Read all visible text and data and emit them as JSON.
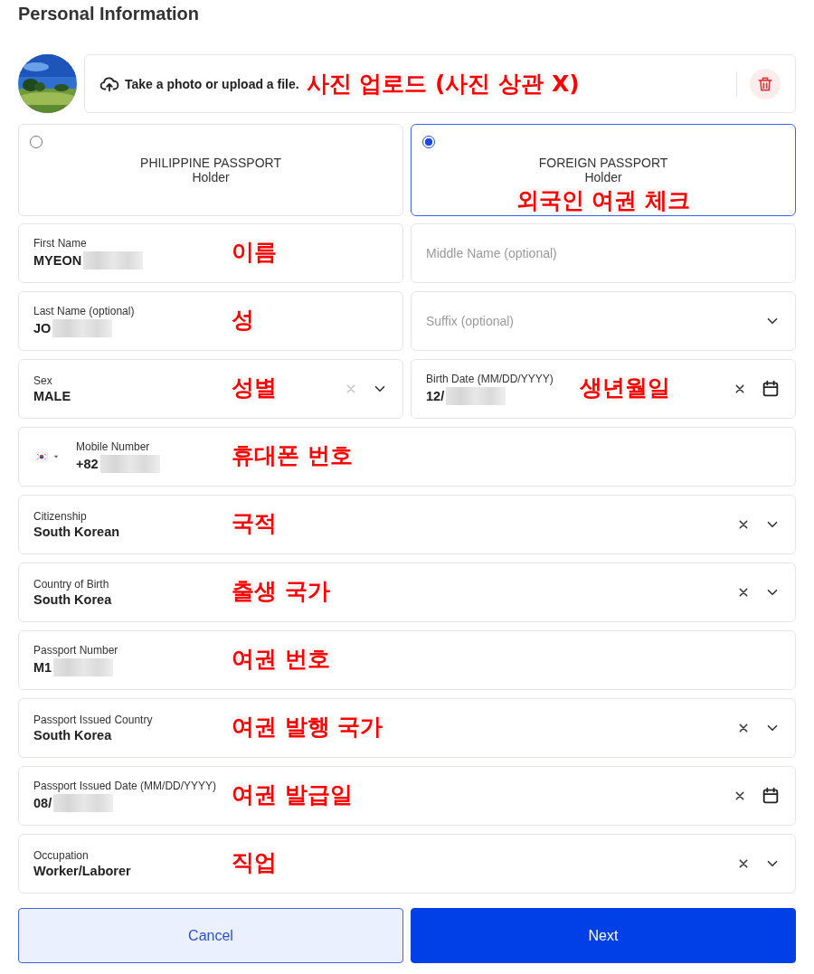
{
  "title": "Personal Information",
  "upload": {
    "text": "Take a photo or upload a file.",
    "annotation": "사진 업로드 (사진 상관 X)"
  },
  "passport_types": [
    {
      "title": "PHILIPPINE PASSPORT",
      "subtitle": "Holder",
      "selected": false
    },
    {
      "title": "FOREIGN PASSPORT",
      "subtitle": "Holder",
      "selected": true,
      "annotation": "외국인 여권 체크"
    }
  ],
  "rows": [
    {
      "fields": [
        {
          "kind": "text",
          "label": "First Name",
          "value": "MYEON",
          "redacted": true,
          "annotation": "이름"
        },
        {
          "kind": "text",
          "placeholder": "Middle Name (optional)"
        }
      ]
    },
    {
      "fields": [
        {
          "kind": "text",
          "label": "Last Name (optional)",
          "value": "JO",
          "redacted": true,
          "annotation": "성"
        },
        {
          "kind": "select",
          "placeholder": "Suffix (optional)"
        }
      ]
    },
    {
      "fields": [
        {
          "kind": "select",
          "label": "Sex",
          "value": "MALE",
          "clear_enabled": false,
          "annotation": "성별"
        },
        {
          "kind": "date",
          "label": "Birth Date (MM/DD/YYYY)",
          "value": "12/",
          "redacted": true,
          "clear_enabled": true,
          "annotation": "생년월일"
        }
      ]
    },
    {
      "fields": [
        {
          "kind": "phone",
          "label": "Mobile Number",
          "value": "+82",
          "redacted": true,
          "annotation": "휴대폰 번호"
        }
      ]
    },
    {
      "fields": [
        {
          "kind": "select",
          "label": "Citizenship",
          "value": "South Korean",
          "clear_enabled": true,
          "annotation": "국적"
        }
      ]
    },
    {
      "fields": [
        {
          "kind": "select",
          "label": "Country of Birth",
          "value": "South Korea",
          "clear_enabled": true,
          "annotation": "출생 국가"
        }
      ]
    },
    {
      "fields": [
        {
          "kind": "text",
          "label": "Passport Number",
          "value": "M1",
          "redacted": true,
          "annotation": "여권 번호"
        }
      ]
    },
    {
      "fields": [
        {
          "kind": "select",
          "label": "Passport Issued Country",
          "value": "South Korea",
          "clear_enabled": true,
          "annotation": "여권 발행 국가"
        }
      ]
    },
    {
      "fields": [
        {
          "kind": "date",
          "label": "Passport Issued Date (MM/DD/YYYY)",
          "value": "08/",
          "redacted": true,
          "clear_enabled": true,
          "annotation": "여권 발급일"
        }
      ]
    },
    {
      "fields": [
        {
          "kind": "select",
          "label": "Occupation",
          "value": "Worker/Laborer",
          "clear_enabled": true,
          "annotation": "직업"
        }
      ]
    }
  ],
  "buttons": [
    {
      "label": "Cancel",
      "kind": "secondary"
    },
    {
      "label": "Next",
      "kind": "primary"
    }
  ]
}
